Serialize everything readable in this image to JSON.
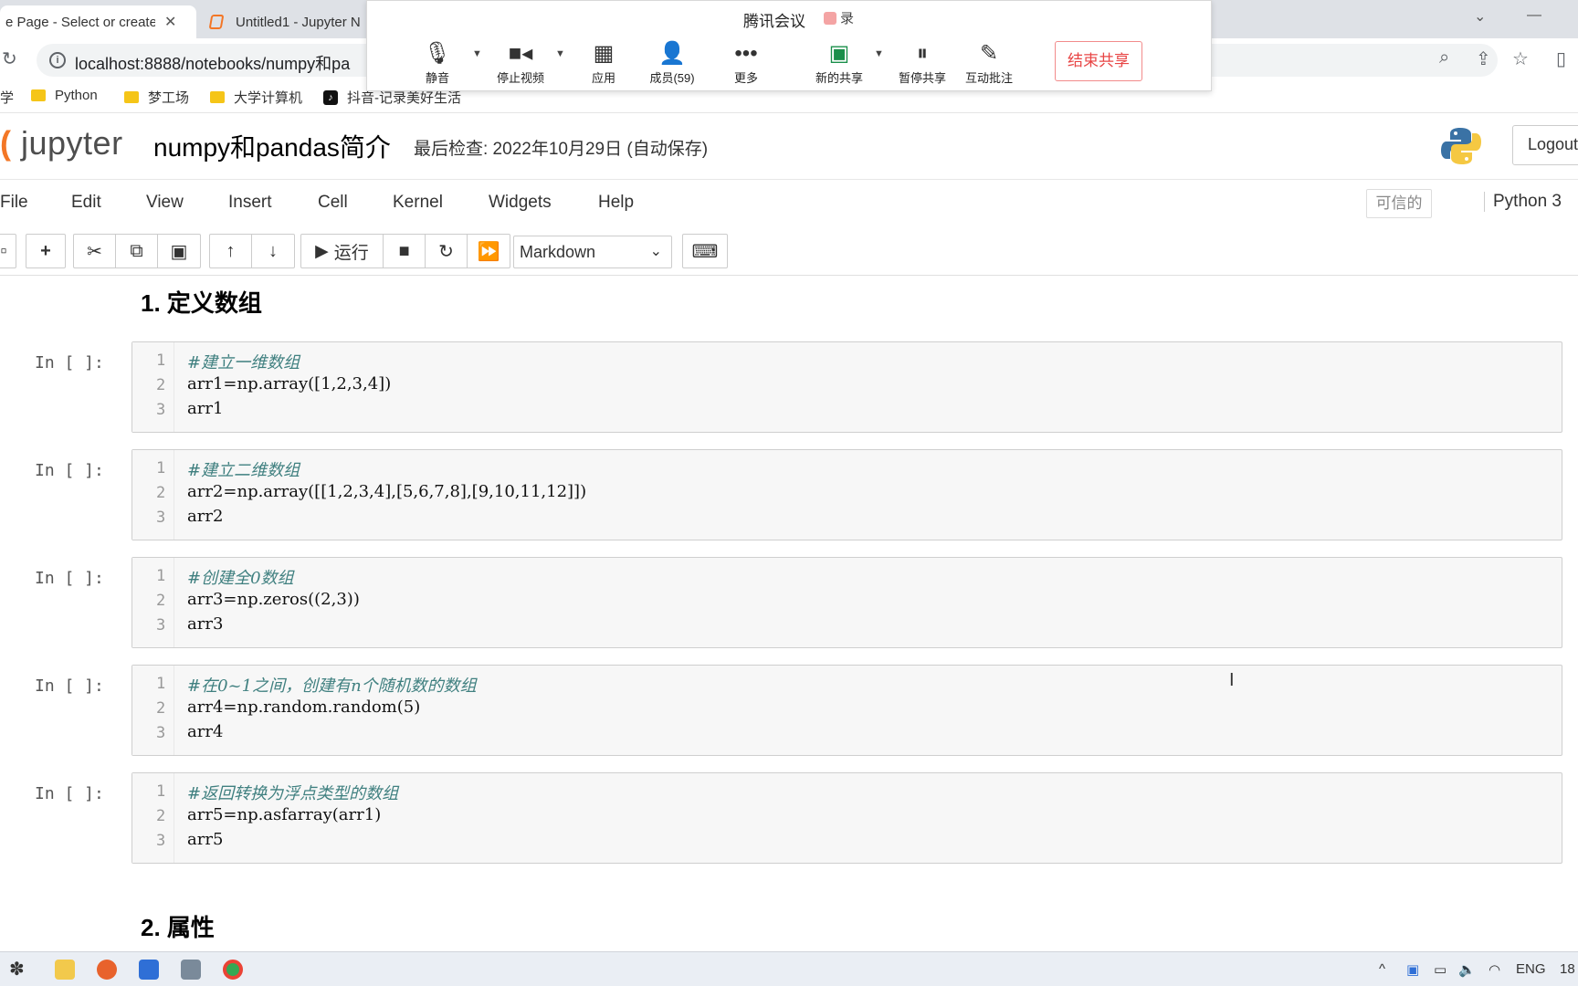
{
  "browser": {
    "tabs": [
      {
        "label": "e Page - Select or create a",
        "close": "✕"
      },
      {
        "label": "Untitled1 - Jupyter N"
      }
    ],
    "url": "localhost:8888/notebooks/numpy和pa",
    "bookmarks": [
      "学",
      "Python",
      "梦工场",
      "大学计算机",
      "抖音-记录美好生活"
    ]
  },
  "meeting": {
    "title": "腾讯会议",
    "rec": "录",
    "tools": [
      "静音",
      "停止视频",
      "应用",
      "成员(59)",
      "更多",
      "新的共享",
      "暂停共享",
      "互动批注"
    ],
    "stop_share": "结束共享"
  },
  "jupyter": {
    "logo_text": "jupyter",
    "notebook_title": "numpy和pandas简介",
    "checkpoint": "最后检查: 2022年10月29日  (自动保存)",
    "logout": "Logout",
    "menus": [
      "File",
      "Edit",
      "View",
      "Insert",
      "Cell",
      "Kernel",
      "Widgets",
      "Help"
    ],
    "trusted": "可信的",
    "kernel": "Python 3",
    "toolbar": {
      "run_label": "运行",
      "cell_type": "Markdown"
    }
  },
  "notebook": {
    "heading1": "1. 定义数组",
    "heading2": "2. 属性",
    "prompt": "In [ ]:",
    "cells": [
      {
        "lines": [
          "#建立一维数组",
          "arr1=np.array([1,2,3,4])",
          "arr1"
        ]
      },
      {
        "lines": [
          "#建立二维数组",
          "arr2=np.array([[1,2,3,4],[5,6,7,8],[9,10,11,12]])",
          "arr2"
        ]
      },
      {
        "lines": [
          "#创建全0数组",
          "arr3=np.zeros((2,3))",
          "arr3"
        ]
      },
      {
        "lines": [
          "#在0~1之间，创建有n个随机数的数组",
          "arr4=np.random.random(5)",
          "arr4"
        ]
      },
      {
        "lines": [
          "#返回转换为浮点类型的数组",
          "arr5=np.asfarray(arr1)",
          "arr5"
        ]
      }
    ],
    "line_numbers": [
      "1",
      "2",
      "3"
    ]
  },
  "taskbar": {
    "lang": "ENG",
    "time": "18"
  },
  "colors": {
    "jupyter_orange": "#f37726",
    "comment": "#408080",
    "stop_share_red": "#e84545"
  }
}
